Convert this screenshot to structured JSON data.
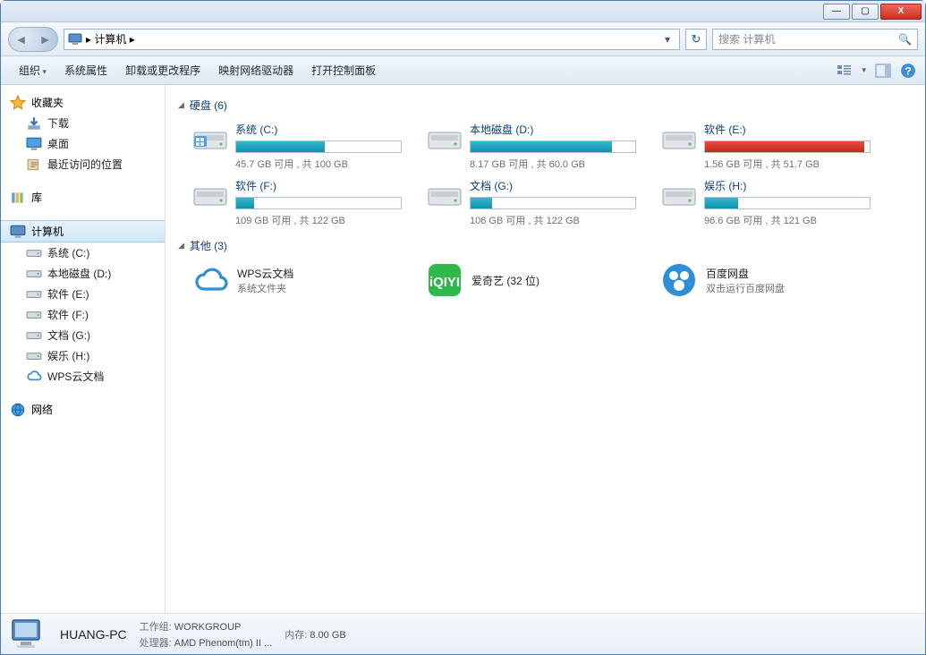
{
  "window": {
    "min": "—",
    "max": "▢",
    "close": "X"
  },
  "nav": {
    "path_icon": "computer-icon",
    "deco": "▸",
    "path": "计算机 ▸",
    "search_placeholder": "搜索 计算机"
  },
  "toolbar": {
    "items": [
      "组织",
      "系统属性",
      "卸载或更改程序",
      "映射网络驱动器",
      "打开控制面板"
    ]
  },
  "sidebar": {
    "favorites": {
      "title": "收藏夹",
      "items": [
        "下载",
        "桌面",
        "最近访问的位置"
      ]
    },
    "libraries": {
      "title": "库"
    },
    "computer": {
      "title": "计算机",
      "items": [
        "系统 (C:)",
        "本地磁盘 (D:)",
        "软件 (E:)",
        "软件 (F:)",
        "文档 (G:)",
        "娱乐 (H:)",
        "WPS云文档"
      ]
    },
    "network": {
      "title": "网络"
    }
  },
  "sections": {
    "drives_title": "硬盘 (6)",
    "other_title": "其他 (3)"
  },
  "drives": [
    {
      "name": "系统 (C:)",
      "info": "45.7 GB 可用 , 共 100 GB",
      "fill": 54,
      "red": false,
      "sys": true
    },
    {
      "name": "本地磁盘 (D:)",
      "info": "8.17 GB 可用 , 共 60.0 GB",
      "fill": 86,
      "red": false,
      "sys": false
    },
    {
      "name": "软件 (E:)",
      "info": "1.56 GB 可用 , 共 51.7 GB",
      "fill": 97,
      "red": true,
      "sys": false
    },
    {
      "name": "软件 (F:)",
      "info": "109 GB 可用 , 共 122 GB",
      "fill": 11,
      "red": false,
      "sys": false
    },
    {
      "name": "文档 (G:)",
      "info": "106 GB 可用 , 共 122 GB",
      "fill": 13,
      "red": false,
      "sys": false
    },
    {
      "name": "娱乐 (H:)",
      "info": "96.6 GB 可用 , 共 121 GB",
      "fill": 20,
      "red": false,
      "sys": false
    }
  ],
  "others": [
    {
      "name": "WPS云文档",
      "sub": "系统文件夹",
      "icon": "cloud"
    },
    {
      "name": "爱奇艺 (32 位)",
      "sub": "",
      "icon": "iqiyi"
    },
    {
      "name": "百度网盘",
      "sub": "双击运行百度网盘",
      "icon": "baidu"
    }
  ],
  "details": {
    "name": "HUANG-PC",
    "workgroup_label": "工作组:",
    "workgroup": "WORKGROUP",
    "cpu_label": "处理器:",
    "cpu": "AMD Phenom(tm) II ...",
    "mem_label": "内存:",
    "mem": "8.00 GB"
  }
}
